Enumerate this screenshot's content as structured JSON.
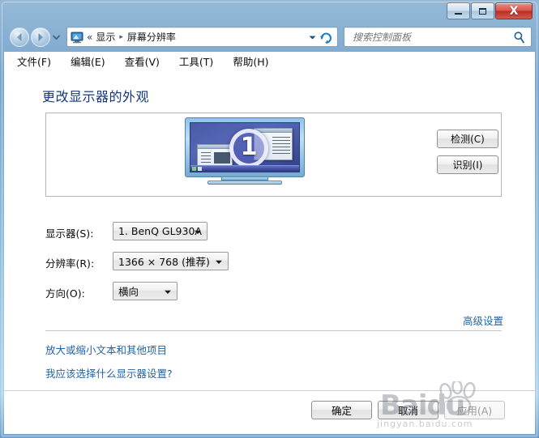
{
  "window": {
    "controls": {
      "minimize_label": "Minimize",
      "maximize_label": "Maximize",
      "close_label": "X"
    }
  },
  "navbar": {
    "back_label": "Back",
    "forward_label": "Forward",
    "breadcrumb_root": "«",
    "breadcrumb": [
      "显示",
      "屏幕分辨率"
    ],
    "breadcrumb_arrow": "▸",
    "search_placeholder": "搜索控制面板",
    "search_value": ""
  },
  "menubar": {
    "items": [
      {
        "label": "文件(F)"
      },
      {
        "label": "编辑(E)"
      },
      {
        "label": "查看(V)"
      },
      {
        "label": "工具(T)"
      },
      {
        "label": "帮助(H)"
      }
    ]
  },
  "main": {
    "page_title": "更改显示器的外观",
    "monitor_badge": "1",
    "detect_button": "检测(C)",
    "identify_button": "识别(I)",
    "fields": [
      {
        "label": "显示器(S):",
        "value": "1. BenQ GL930A"
      },
      {
        "label": "分辨率(R):",
        "value": "1366 × 768 (推荐)"
      },
      {
        "label": "方向(O):",
        "value": "横向"
      }
    ],
    "advanced_link": "高级设置",
    "links": [
      {
        "label": "放大或缩小文本和其他项目"
      },
      {
        "label": "我应该选择什么显示器设置?"
      }
    ]
  },
  "footer": {
    "ok_button": "确定",
    "cancel_button": "取消",
    "apply_button": "应用(A)"
  },
  "watermark": {
    "text": "Baidu",
    "subtitle": "jingyan.baidu.com"
  },
  "colors": {
    "title_blue": "#14377a",
    "link_blue": "#2463a4",
    "frame_blue": "#78a5cd",
    "close_red": "#b62d24"
  }
}
